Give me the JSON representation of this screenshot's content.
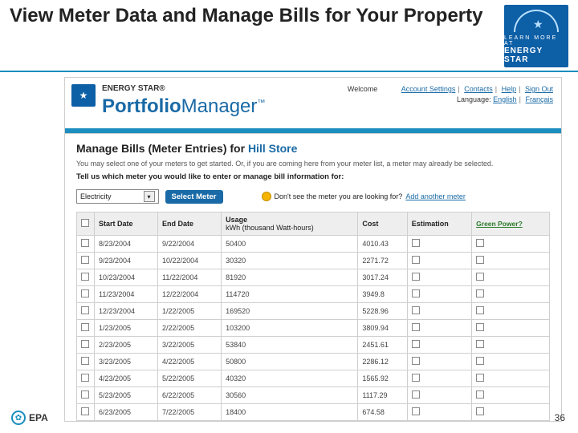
{
  "slide": {
    "title": "View Meter Data and Manage Bills for Your Property",
    "page_number": "36",
    "epa_text": "EPA"
  },
  "badge": {
    "t1": "LEARN MORE AT",
    "t2": "ENERGY STAR"
  },
  "header": {
    "brand_small": "ENERGY STAR®",
    "brand_prefix": "Portfolio",
    "brand_suffix": "Manager",
    "tm": "™",
    "welcome": "Welcome",
    "links": {
      "account": "Account Settings",
      "contacts": "Contacts",
      "help": "Help",
      "signout": "Sign Out"
    },
    "lang_label": "Language:",
    "lang_en": "English",
    "lang_fr": "Français"
  },
  "page": {
    "heading_prefix": "Manage Bills (Meter Entries) for ",
    "property_name": "Hill Store",
    "sub": "You may select one of your meters to get started. Or, if you are coming here from your meter list, a meter may already be selected.",
    "instruction": "Tell us which meter you would like to enter or manage bill information for:"
  },
  "selector": {
    "dropdown_value": "Electricity",
    "button_label": "Select Meter",
    "hint_text": "Don't see the meter you are looking for? ",
    "hint_link": "Add another meter"
  },
  "table": {
    "cols": {
      "start": "Start Date",
      "end": "End Date",
      "usage_l1": "Usage",
      "usage_l2": "kWh (thousand Watt-hours)",
      "cost": "Cost",
      "est": "Estimation",
      "green": "Green Power?"
    },
    "rows": [
      {
        "start": "8/23/2004",
        "end": "9/22/2004",
        "usage": "50400",
        "cost": "4010.43"
      },
      {
        "start": "9/23/2004",
        "end": "10/22/2004",
        "usage": "30320",
        "cost": "2271.72"
      },
      {
        "start": "10/23/2004",
        "end": "11/22/2004",
        "usage": "81920",
        "cost": "3017.24"
      },
      {
        "start": "11/23/2004",
        "end": "12/22/2004",
        "usage": "114720",
        "cost": "3949.8"
      },
      {
        "start": "12/23/2004",
        "end": "1/22/2005",
        "usage": "169520",
        "cost": "5228.96"
      },
      {
        "start": "1/23/2005",
        "end": "2/22/2005",
        "usage": "103200",
        "cost": "3809.94"
      },
      {
        "start": "2/23/2005",
        "end": "3/22/2005",
        "usage": "53840",
        "cost": "2451.61"
      },
      {
        "start": "3/23/2005",
        "end": "4/22/2005",
        "usage": "50800",
        "cost": "2286.12"
      },
      {
        "start": "4/23/2005",
        "end": "5/22/2005",
        "usage": "40320",
        "cost": "1565.92"
      },
      {
        "start": "5/23/2005",
        "end": "6/22/2005",
        "usage": "30560",
        "cost": "1117.29"
      },
      {
        "start": "6/23/2005",
        "end": "7/22/2005",
        "usage": "18400",
        "cost": "674.58"
      }
    ]
  }
}
